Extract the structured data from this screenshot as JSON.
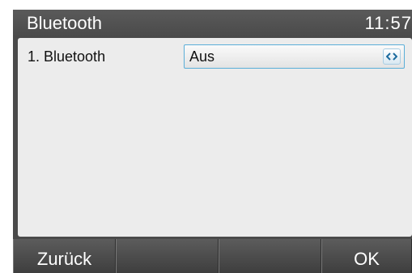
{
  "titlebar": {
    "title": "Bluetooth",
    "time": "11:57"
  },
  "settings": {
    "items": [
      {
        "label": "1. Bluetooth",
        "value": "Aus",
        "control_icon": "left-right-arrows-icon"
      }
    ]
  },
  "softkeys": [
    {
      "label": "Zurück"
    },
    {
      "label": ""
    },
    {
      "label": ""
    },
    {
      "label": "OK"
    }
  ],
  "colors": {
    "frame": "#4a4a4a",
    "content_background": "#ececec",
    "select_border": "#5aaed8",
    "arrow_icon": "#1b6a9e",
    "text_light": "#ffffff",
    "text_dark": "#111111"
  }
}
